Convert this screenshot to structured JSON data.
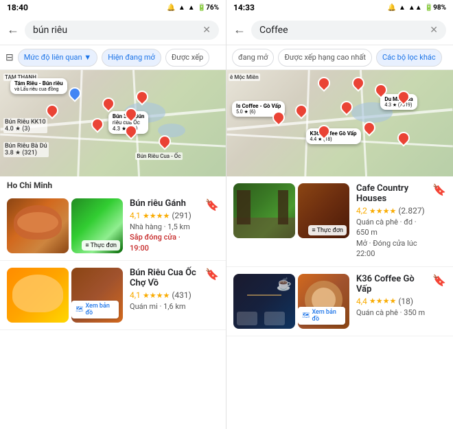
{
  "left_panel": {
    "status_bar": {
      "time": "18:40",
      "icons": "🔔📶📶🔋76%"
    },
    "search": {
      "query": "bún riêu",
      "placeholder": "bún riêu"
    },
    "filters": [
      {
        "label": "Mức độ liên quan ▼",
        "active": true
      },
      {
        "label": "Hiện đang mở",
        "active": true
      },
      {
        "label": "Được xếp",
        "active": false
      }
    ],
    "map_labels": [
      {
        "text": "TAM THANH",
        "pos": "l1"
      },
      {
        "text": "Tám Riêu - Bún riêu\nvà Lẩu riêu cua đồng",
        "pos": "l2"
      },
      {
        "text": "Bún Riêu KK10\n4.0 ★ (3)",
        "pos": "l3"
      },
      {
        "text": "Bún Riêu Bà Dú\n3.8 ★ (321)",
        "pos": "l4"
      },
      {
        "text": "Bún 30 - Bún\nriêu cua Ốc",
        "pos": "l5"
      },
      {
        "text": "4.3 ★ (12)",
        "pos": "l6"
      },
      {
        "text": "Bún Riêu Cua - Ốc",
        "pos": "l7"
      }
    ],
    "section_title": "Ho Chi Minh",
    "results": [
      {
        "name": "Bún riêu Gánh",
        "rating": "4,1",
        "stars": "★★★★",
        "review_count": "(291)",
        "meta1": "Nhà hàng · 1,5 km",
        "meta2": "Sắp đóng cửa · 19:00",
        "status": "closed",
        "has_menu": true,
        "img_label": "Thực đơn"
      },
      {
        "name": "Bún Riêu Cua Ốc Chợ Vồ",
        "rating": "4,1",
        "stars": "★★★★",
        "review_count": "(431)",
        "meta1": "Quán mi · 1,6 km",
        "meta2": "",
        "status": "open",
        "has_menu": false,
        "has_map": true,
        "map_label": "Xem bản đồ"
      }
    ]
  },
  "right_panel": {
    "status_bar": {
      "time": "14:33",
      "icons": "🔔📶📶🔋98%"
    },
    "search": {
      "query": "Coffee",
      "placeholder": "Coffee"
    },
    "filters": [
      {
        "label": "đang mở",
        "active": false
      },
      {
        "label": "Được xếp hạng cao nhất",
        "active": false
      },
      {
        "label": "Các bộ lọc khác",
        "active": true
      }
    ],
    "map_labels": [
      {
        "text": "ê Mộc Miên",
        "pos": "r1"
      },
      {
        "text": "Is Coffee - Gò Vấp\n5.0 ★ (6)",
        "pos": "r3"
      },
      {
        "text": "K36 Coffee Gò Vấp\n4.4 ★ (18)",
        "pos": "r4"
      },
      {
        "text": "Du Miên Ga\n4.3 ★ (7519)",
        "pos": "r6"
      }
    ],
    "results": [
      {
        "name": "Cafe Country Houses",
        "rating": "4,2",
        "stars": "★★★★",
        "review_count": "(2.827)",
        "meta1": "Quán cà phê · đd · 650 m",
        "meta2": "Mở · Đóng cửa lúc 22:00",
        "status": "open",
        "has_menu": true,
        "img_label": "Thực đơn"
      },
      {
        "name": "K36 Coffee Gò Vấp",
        "rating": "4,4",
        "stars": "★★★★",
        "review_count": "(18)",
        "meta1": "Quán cà phê · 350 m",
        "meta2": "",
        "status": "open",
        "has_menu": false,
        "has_map": true,
        "map_label": "Xem bản đồ"
      }
    ]
  },
  "icons": {
    "back": "←",
    "clear": "✕",
    "bookmark": "🔖",
    "menu_icon": "≡",
    "map_pin": "📍",
    "filter": "⊞"
  }
}
